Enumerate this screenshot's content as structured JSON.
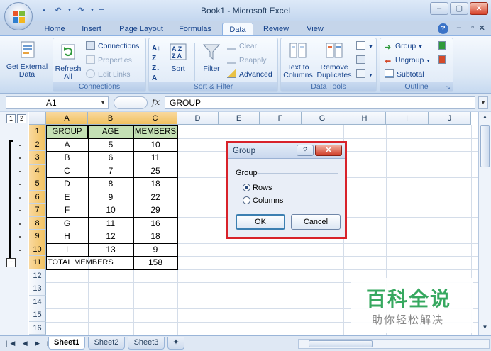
{
  "window": {
    "title": "Book1 - Microsoft Excel",
    "min": "–",
    "max": "▢",
    "close": "✕"
  },
  "tabs": [
    "Home",
    "Insert",
    "Page Layout",
    "Formulas",
    "Data",
    "Review",
    "View"
  ],
  "active_tab": "Data",
  "ribbon": {
    "get_external_data": "Get External Data",
    "refresh_all": "Refresh All",
    "connections": "Connections",
    "properties": "Properties",
    "edit_links": "Edit Links",
    "connections_label": "Connections",
    "sort": "Sort",
    "filter": "Filter",
    "clear": "Clear",
    "reapply": "Reapply",
    "advanced": "Advanced",
    "sort_filter_label": "Sort & Filter",
    "text_to_columns": "Text to Columns",
    "remove_duplicates": "Remove Duplicates",
    "data_tools_label": "Data Tools",
    "group": "Group",
    "ungroup": "Ungroup",
    "subtotal": "Subtotal",
    "outline_label": "Outline"
  },
  "formula_bar": {
    "name_box": "A1",
    "fx": "fx",
    "formula": "GROUP"
  },
  "outline_levels": [
    "1",
    "2"
  ],
  "columns": [
    "A",
    "B",
    "C",
    "D",
    "E",
    "F",
    "G",
    "H",
    "I",
    "J"
  ],
  "rows": [
    "1",
    "2",
    "3",
    "4",
    "5",
    "6",
    "7",
    "8",
    "9",
    "10",
    "11",
    "12",
    "13",
    "14",
    "15",
    "16"
  ],
  "table": {
    "headers": [
      "GROUP",
      "AGE",
      "MEMBERS"
    ],
    "rows": [
      [
        "A",
        "5",
        "10"
      ],
      [
        "B",
        "6",
        "11"
      ],
      [
        "C",
        "7",
        "25"
      ],
      [
        "D",
        "8",
        "18"
      ],
      [
        "E",
        "9",
        "22"
      ],
      [
        "F",
        "10",
        "29"
      ],
      [
        "G",
        "11",
        "16"
      ],
      [
        "H",
        "12",
        "18"
      ],
      [
        "I",
        "13",
        "9"
      ]
    ],
    "total_label": "TOTAL MEMBERS",
    "total_value": "158"
  },
  "dialog": {
    "title": "Group",
    "help": "?",
    "close": "✕",
    "section_label": "Group",
    "option_rows": "Rows",
    "option_columns": "Columns",
    "selected": "Rows",
    "ok": "OK",
    "cancel": "Cancel"
  },
  "sheets": [
    "Sheet1",
    "Sheet2",
    "Sheet3"
  ],
  "active_sheet": "Sheet1",
  "watermark": {
    "big": "百科全说",
    "small": "助你轻松解决"
  },
  "colors": {
    "header_fill": "#c4e0b4",
    "dialog_highlight": "#d8222a",
    "watermark_green": "#36a85f"
  }
}
